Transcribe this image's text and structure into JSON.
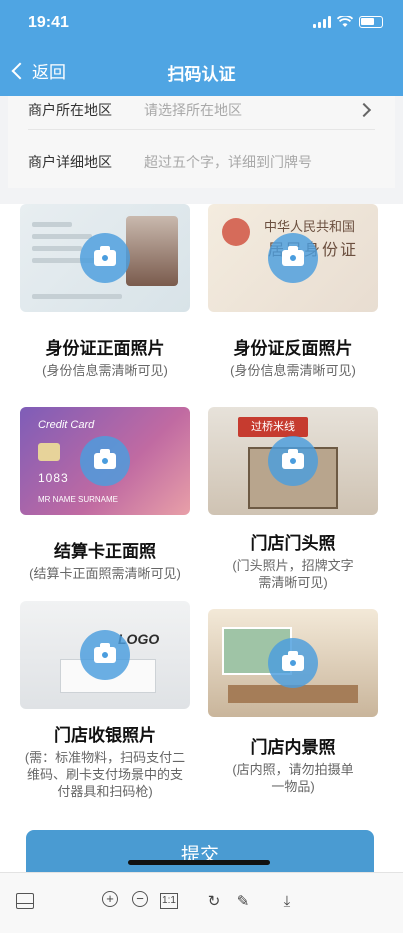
{
  "status_bar": {
    "time": "19:41"
  },
  "nav": {
    "back_label": "返回",
    "title": "扫码认证"
  },
  "form": {
    "region": {
      "label": "商户所在地区",
      "placeholder": "请选择所在地区"
    },
    "address": {
      "label": "商户详细地区",
      "placeholder": "超过五个字，详细到门牌号"
    }
  },
  "cards": [
    {
      "caption": "身份证正面照片",
      "hint": "(身份信息需清晰可见)"
    },
    {
      "caption": "身份证反面照片",
      "hint": "(身份信息需清晰可见)"
    },
    {
      "caption": "结算卡正面照",
      "hint": "(结算卡正面照需清晰可见)"
    },
    {
      "caption": "门店门头照",
      "hint": "(门头照片，招牌文字需清晰可见)"
    },
    {
      "caption": "门店收银照片",
      "hint": "(需：标准物料，扫码支付二维码、刷卡支付场景中的支付器具和扫码枪)"
    },
    {
      "caption": "门店内景照",
      "hint": "(店内照，请勿拍摄单一物品)"
    }
  ],
  "thumb_text": {
    "id_back_line1": "中华人民共和国",
    "id_back_line2": "居民身份证",
    "card_title": "Credit Card",
    "card_number": "1083",
    "card_name": "MR NAME SURNAME",
    "store_sign": "过桥米线",
    "cashier_logo": "LOGO"
  },
  "submit_label": "提交",
  "toolbar_icons": [
    "layout-icon",
    "zoom-in-icon",
    "zoom-out-icon",
    "actual-size-icon",
    "rotate-icon",
    "edit-icon",
    "download-icon"
  ]
}
